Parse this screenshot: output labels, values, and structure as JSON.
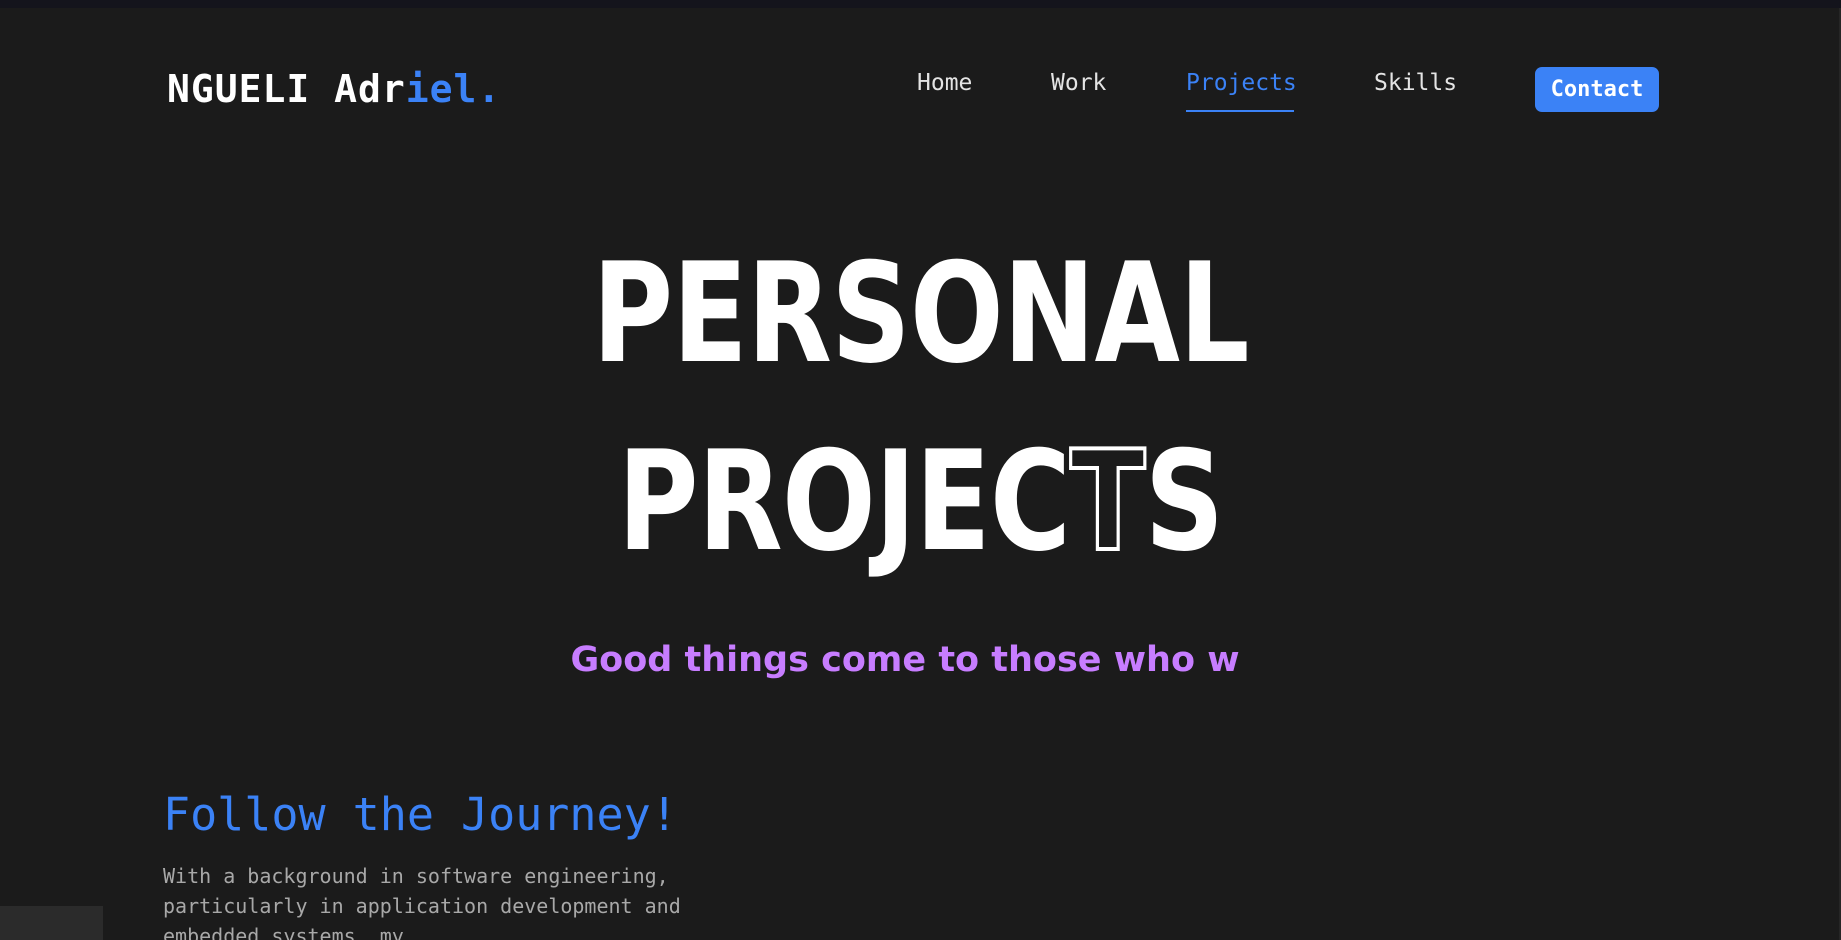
{
  "header": {
    "logo": {
      "part_white": "NGUELI Adr",
      "part_blue": "iel."
    },
    "nav": [
      {
        "label": "Home",
        "active": false
      },
      {
        "label": "Work",
        "active": false
      },
      {
        "label": "Projects",
        "active": true
      },
      {
        "label": "Skills",
        "active": false
      }
    ],
    "contact_label": "Contact"
  },
  "hero": {
    "line1": "PERSONAL",
    "line2_main": "PROJEC",
    "line2_outlined": "T",
    "line2_end": "S",
    "tagline": "Good things come to those who w"
  },
  "journey": {
    "title": "Follow the Journey!",
    "text": "With a background in software engineering, particularly in application development and embedded systems, my"
  },
  "colors": {
    "background": "#1b1b1b",
    "accent": "#3b82f6",
    "tagline": "#c77dff"
  }
}
